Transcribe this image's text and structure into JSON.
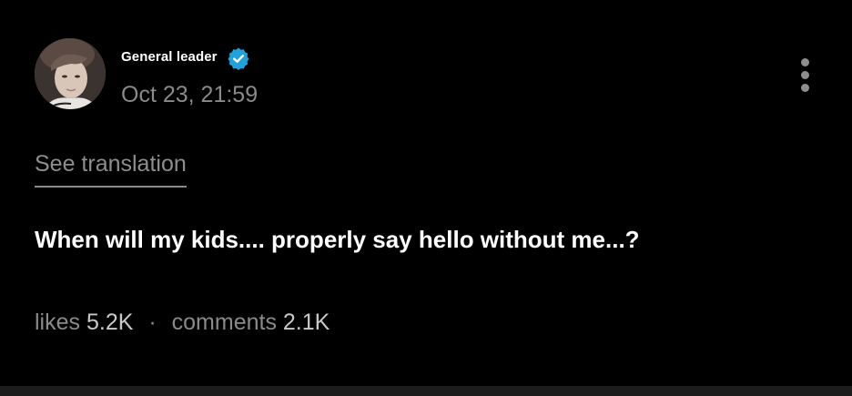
{
  "post": {
    "author_name": "General leader",
    "verified_icon": "verified-badge-icon",
    "timestamp": "Oct 23, 21:59",
    "see_translation_label": "See translation",
    "text": "When will my kids.... properly say hello without me...?",
    "more_icon": "more-vertical-icon"
  },
  "stats": {
    "likes_label": "likes",
    "likes_value": "5.2K",
    "separator": "·",
    "comments_label": "comments",
    "comments_value": "2.1K"
  },
  "colors": {
    "background": "#000000",
    "verified_badge": "#1ea3dc",
    "muted_text": "#8a8a8a",
    "primary_text": "#ffffff"
  }
}
